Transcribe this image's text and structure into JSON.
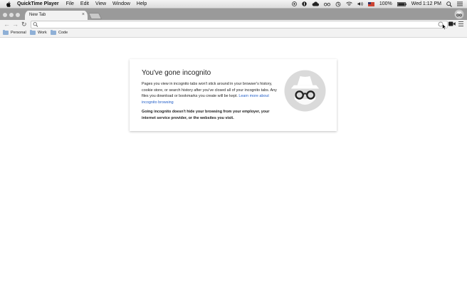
{
  "menubar": {
    "app_name": "QuickTime Player",
    "items": [
      "File",
      "Edit",
      "View",
      "Window",
      "Help"
    ],
    "battery": "100%",
    "clock": "Wed 1:12 PM"
  },
  "tab": {
    "title": "New Tab",
    "close_glyph": "×"
  },
  "nav": {
    "back_glyph": "←",
    "forward_glyph": "→",
    "reload_glyph": "↻"
  },
  "omnibox": {
    "value": "",
    "placeholder": ""
  },
  "bookmarks": [
    {
      "label": "Personal"
    },
    {
      "label": "Work"
    },
    {
      "label": "Code"
    }
  ],
  "incognito": {
    "heading": "You've gone incognito",
    "body_before_link": "Pages you view in incognito tabs won't stick around in your browser's history, cookie store, or search history after you've closed all of your incognito tabs. Any files you download or bookmarks you create will be kept. ",
    "link_text": "Learn more about incognito browsing",
    "warning": "Going incognito doesn't hide your browsing from your employer, your internet service provider, or the websites you visit."
  },
  "icons": {
    "apple": "apple-icon",
    "incognito": "incognito-icon",
    "camera": "camera-icon",
    "menu": "hamburger-menu-icon",
    "search": "search-icon"
  },
  "colors": {
    "link": "#2560c8",
    "tabstrip": "#9a9a9a",
    "folder": "#8fb0d6"
  }
}
